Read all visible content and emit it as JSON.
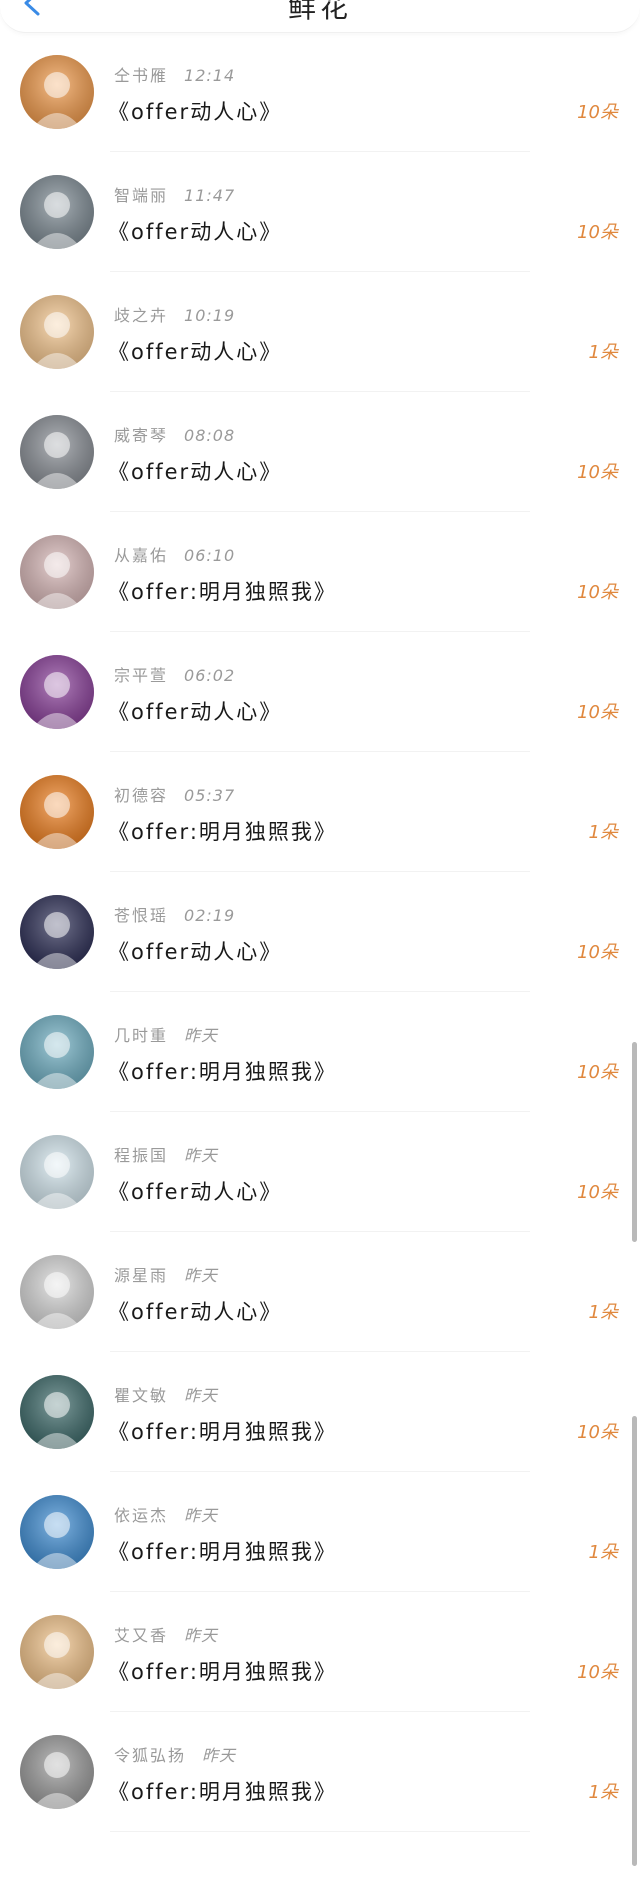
{
  "header": {
    "title": "鲜花"
  },
  "rows": [
    {
      "name": "仝书雁",
      "time": "12:14",
      "gift": "《offer动人心》",
      "count": "10朵",
      "avatar_color": "#f39b4a",
      "avatar_icon": "cartoon-rabbit-avatar"
    },
    {
      "name": "智端丽",
      "time": "11:47",
      "gift": "《offer动人心》",
      "count": "10朵",
      "avatar_color": "#7d8a93",
      "avatar_icon": "cat-in-hat-avatar"
    },
    {
      "name": "歧之卉",
      "time": "10:19",
      "gift": "《offer动人心》",
      "count": "1朵",
      "avatar_color": "#f6c78e",
      "avatar_icon": "cartoon-peach-avatar"
    },
    {
      "name": "威寄琴",
      "time": "08:08",
      "gift": "《offer动人心》",
      "count": "10朵",
      "avatar_color": "#8a8f96",
      "avatar_icon": "room-photo-avatar"
    },
    {
      "name": "从嘉佑",
      "time": "06:10",
      "gift": "《offer:明月独照我》",
      "count": "10朵",
      "avatar_color": "#d9b8b8",
      "avatar_icon": "person-photo-avatar"
    },
    {
      "name": "宗平萱",
      "time": "06:02",
      "gift": "《offer动人心》",
      "count": "10朵",
      "avatar_color": "#8a3e9a",
      "avatar_icon": "anime-girl-avatar"
    },
    {
      "name": "初德容",
      "time": "05:37",
      "gift": "《offer:明月独照我》",
      "count": "1朵",
      "avatar_color": "#f07f1e",
      "avatar_icon": "orange-poster-avatar"
    },
    {
      "name": "苍恨瑶",
      "time": "02:19",
      "gift": "《offer动人心》",
      "count": "10朵",
      "avatar_color": "#2b2d55",
      "avatar_icon": "game-hero-avatar"
    },
    {
      "name": "几时重",
      "time": "昨天",
      "gift": "《offer:明月独照我》",
      "count": "10朵",
      "avatar_color": "#6fb0c4",
      "avatar_icon": "long-hair-girl-avatar"
    },
    {
      "name": "程振国",
      "time": "昨天",
      "gift": "《offer动人心》",
      "count": "10朵",
      "avatar_color": "#d4e7ef",
      "avatar_icon": "girl-portrait-avatar"
    },
    {
      "name": "源星雨",
      "time": "昨天",
      "gift": "《offer动人心》",
      "count": "1朵",
      "avatar_color": "#d9d9d9",
      "avatar_icon": "dark-hair-girl-avatar"
    },
    {
      "name": "瞿文敏",
      "time": "昨天",
      "gift": "《offer:明月独照我》",
      "count": "10朵",
      "avatar_color": "#3c6a6a",
      "avatar_icon": "game-character-avatar"
    },
    {
      "name": "依运杰",
      "time": "昨天",
      "gift": "《offer:明月独照我》",
      "count": "1朵",
      "avatar_color": "#3f8fd6",
      "avatar_icon": "surfer-wave-avatar"
    },
    {
      "name": "艾又香",
      "time": "昨天",
      "gift": "《offer:明月独照我》",
      "count": "10朵",
      "avatar_color": "#f3c48a",
      "avatar_icon": "cartoon-couple-avatar"
    },
    {
      "name": "令狐弘扬",
      "time": "昨天",
      "gift": "《offer:明月独照我》",
      "count": "1朵",
      "avatar_color": "#9b9b9b",
      "avatar_icon": "gray-photo-avatar"
    }
  ],
  "colors": {
    "count": "#e0883e",
    "name": "#9a9a9a",
    "gift": "#1a1a1a",
    "back_icon": "#3a8be6"
  }
}
